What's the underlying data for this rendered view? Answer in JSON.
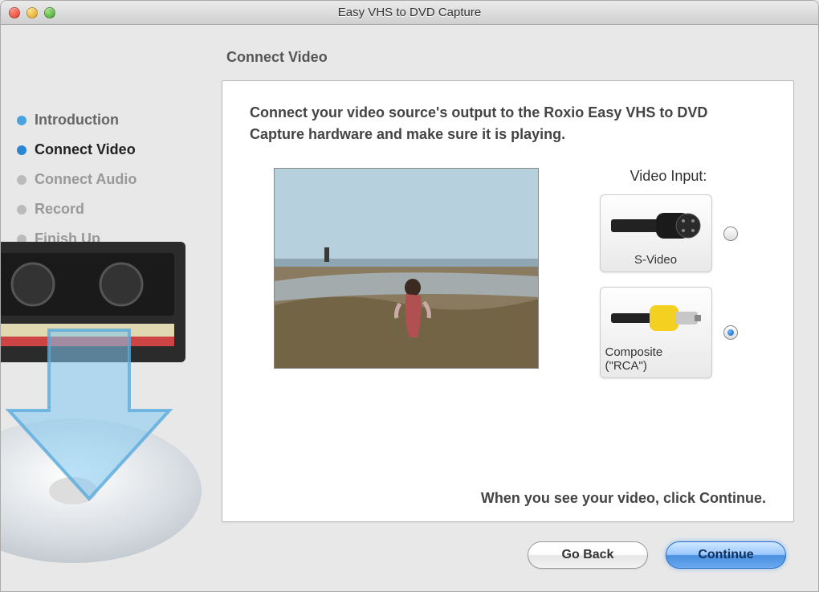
{
  "window": {
    "title": "Easy VHS to DVD Capture"
  },
  "sidebar": {
    "steps": [
      {
        "label": "Introduction",
        "state": "completed"
      },
      {
        "label": "Connect Video",
        "state": "current"
      },
      {
        "label": "Connect Audio",
        "state": "upcoming"
      },
      {
        "label": "Record",
        "state": "upcoming"
      },
      {
        "label": "Finish Up",
        "state": "upcoming"
      }
    ]
  },
  "page": {
    "heading": "Connect Video",
    "instruction": "Connect your video source's output to the Roxio Easy VHS to DVD Capture hardware and make sure it is playing.",
    "video_input_label": "Video Input:",
    "inputs": {
      "svideo": {
        "label": "S-Video",
        "selected": false
      },
      "composite": {
        "label": "Composite (\"RCA\")",
        "selected": true
      }
    },
    "hint": "When you see your video, click Continue."
  },
  "buttons": {
    "back": "Go Back",
    "continue": "Continue"
  }
}
